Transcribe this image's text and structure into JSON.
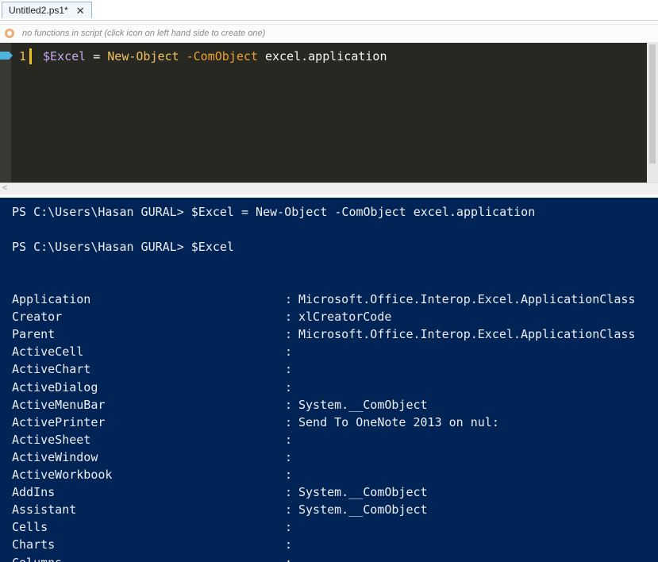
{
  "tab": {
    "title": "Untitled2.ps1*",
    "close_glyph": "✕"
  },
  "function_bar": {
    "icon": "gear-icon",
    "text": "no functions in script (click icon on left hand side to create one)"
  },
  "editor": {
    "line_number": "1",
    "tokens": {
      "var": "$Excel",
      "op": " = ",
      "cmd": "New-Object",
      "param": " -ComObject",
      "arg": " excel.application"
    }
  },
  "console": {
    "prompt1": "PS C:\\Users\\Hasan GURAL> $Excel = New-Object -ComObject excel.application",
    "prompt2": "PS C:\\Users\\Hasan GURAL> $Excel",
    "properties": [
      {
        "name": "Application",
        "colon": ":",
        "value": "Microsoft.Office.Interop.Excel.ApplicationClass"
      },
      {
        "name": "Creator",
        "colon": ":",
        "value": "xlCreatorCode"
      },
      {
        "name": "Parent",
        "colon": ":",
        "value": "Microsoft.Office.Interop.Excel.ApplicationClass"
      },
      {
        "name": "ActiveCell",
        "colon": ":",
        "value": ""
      },
      {
        "name": "ActiveChart",
        "colon": ":",
        "value": ""
      },
      {
        "name": "ActiveDialog",
        "colon": ":",
        "value": ""
      },
      {
        "name": "ActiveMenuBar",
        "colon": ":",
        "value": "System.__ComObject"
      },
      {
        "name": "ActivePrinter",
        "colon": ":",
        "value": "Send To OneNote 2013 on nul:"
      },
      {
        "name": "ActiveSheet",
        "colon": ":",
        "value": ""
      },
      {
        "name": "ActiveWindow",
        "colon": ":",
        "value": ""
      },
      {
        "name": "ActiveWorkbook",
        "colon": ":",
        "value": ""
      },
      {
        "name": "AddIns",
        "colon": ":",
        "value": "System.__ComObject"
      },
      {
        "name": "Assistant",
        "colon": ":",
        "value": "System.__ComObject"
      },
      {
        "name": "Cells",
        "colon": ":",
        "value": ""
      },
      {
        "name": "Charts",
        "colon": ":",
        "value": ""
      },
      {
        "name": "Columns",
        "colon": ":",
        "value": ""
      }
    ]
  },
  "colors": {
    "console_background": "#012456",
    "editor_background": "#272822"
  }
}
